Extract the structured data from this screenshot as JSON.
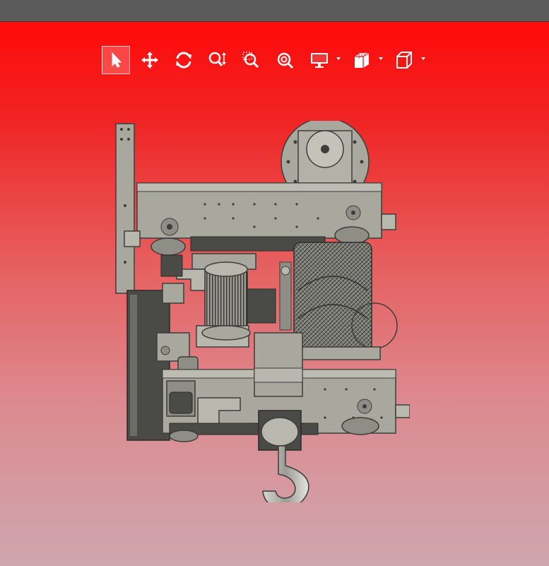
{
  "app": {
    "colors": {
      "title_bar": "#5a5a5a",
      "background_top": "#ff0a0a",
      "background_bottom": "#cfa6ae",
      "toolbar_icon": "#ffffff",
      "model_metal": "#a9a89f",
      "model_dark": "#4a4a46"
    }
  },
  "toolbar": {
    "items": [
      {
        "id": "select",
        "icon": "cursor-arrow-icon",
        "active": true,
        "dropdown": false
      },
      {
        "id": "pan",
        "icon": "move-arrows-icon",
        "active": false,
        "dropdown": false
      },
      {
        "id": "rotate",
        "icon": "rotate-icon",
        "active": false,
        "dropdown": false
      },
      {
        "id": "zoom",
        "icon": "zoom-updown-icon",
        "active": false,
        "dropdown": false
      },
      {
        "id": "zoom-window",
        "icon": "zoom-window-icon",
        "active": false,
        "dropdown": false
      },
      {
        "id": "zoom-fit",
        "icon": "zoom-fit-icon",
        "active": false,
        "dropdown": false
      },
      {
        "id": "display",
        "icon": "monitor-icon",
        "active": false,
        "dropdown": true
      },
      {
        "id": "section",
        "icon": "section-cube-icon",
        "active": false,
        "dropdown": true
      },
      {
        "id": "view",
        "icon": "view-cube-icon",
        "active": false,
        "dropdown": true
      }
    ]
  },
  "viewport": {
    "model": "hoist-trolley-assembly"
  }
}
